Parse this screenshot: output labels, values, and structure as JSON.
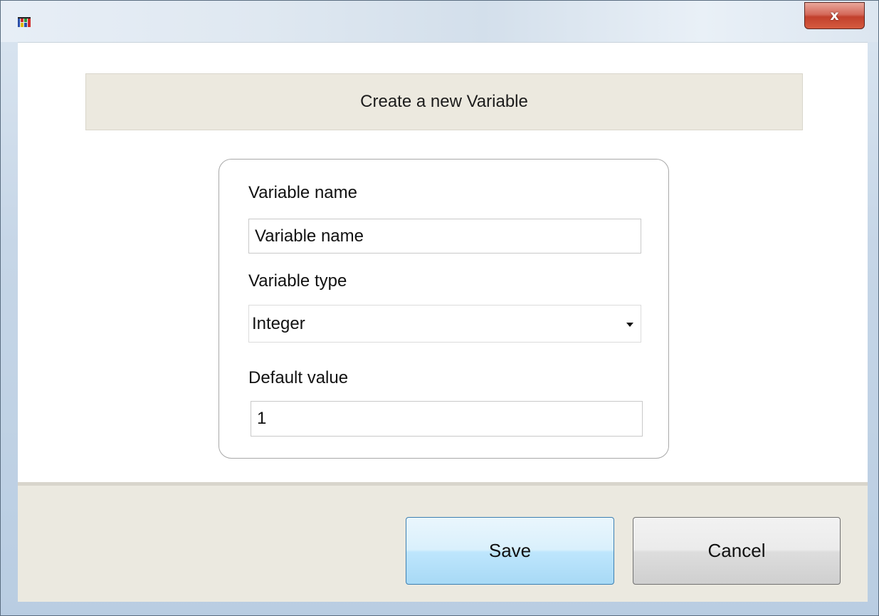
{
  "window": {
    "title": "",
    "close_label": "x"
  },
  "header": {
    "title": "Create a new Variable"
  },
  "form": {
    "name_label": "Variable name",
    "name_value": "Variable name",
    "type_label": "Variable type",
    "type_selected": "Integer",
    "default_label": "Default value",
    "default_value": "1"
  },
  "buttons": {
    "save_label": "Save",
    "cancel_label": "Cancel"
  },
  "icons": {
    "app": "app-icon",
    "close": "close-icon",
    "dropdown": "chevron-down-icon"
  },
  "colors": {
    "save_border": "#3c7fb1",
    "close_red": "#c2402c",
    "banner_bg": "#ece9df"
  }
}
